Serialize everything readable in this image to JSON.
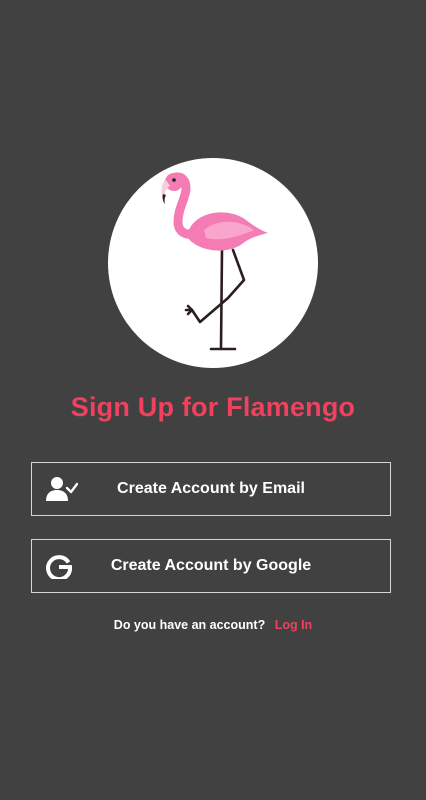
{
  "logo": {
    "icon": "flamingo-icon"
  },
  "title": "Sign Up for Flamengo",
  "buttons": {
    "email": {
      "label": "Create Account by Email",
      "icon": "user-check-icon"
    },
    "google": {
      "label": "Create Account by Google",
      "icon": "google-icon"
    }
  },
  "footer": {
    "prompt": "Do you have an account?",
    "login_link": "Log In"
  },
  "colors": {
    "background": "#414141",
    "accent": "#f0415e",
    "flamingo_pink": "#f47bb3",
    "button_border": "#d6d6d6"
  }
}
